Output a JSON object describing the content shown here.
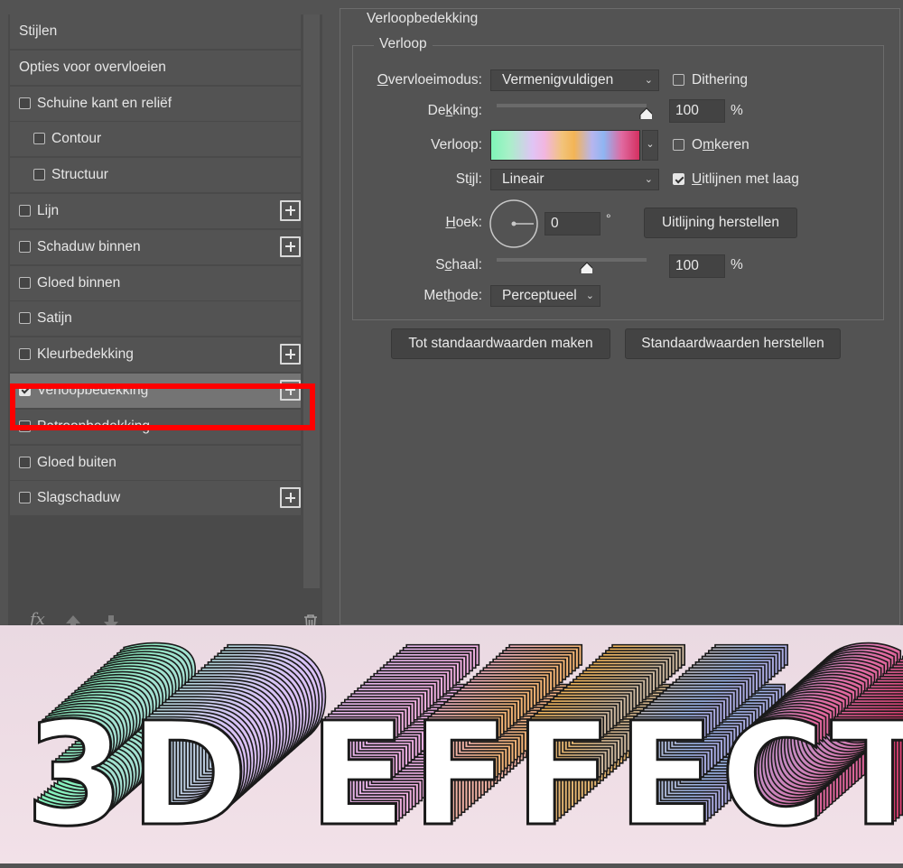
{
  "styles_panel": {
    "items": [
      {
        "label": "Stijlen",
        "checkbox": false,
        "checked": false,
        "indent": 0,
        "plus": false,
        "selected": false
      },
      {
        "label": "Opties voor overvloeien",
        "checkbox": false,
        "checked": false,
        "indent": 0,
        "plus": false,
        "selected": false
      },
      {
        "label": "Schuine kant en reliëf",
        "checkbox": true,
        "checked": false,
        "indent": 0,
        "plus": false,
        "selected": false
      },
      {
        "label": "Contour",
        "checkbox": true,
        "checked": false,
        "indent": 1,
        "plus": false,
        "selected": false
      },
      {
        "label": "Structuur",
        "checkbox": true,
        "checked": false,
        "indent": 1,
        "plus": false,
        "selected": false
      },
      {
        "label": "Lijn",
        "checkbox": true,
        "checked": false,
        "indent": 0,
        "plus": true,
        "selected": false
      },
      {
        "label": "Schaduw binnen",
        "checkbox": true,
        "checked": false,
        "indent": 0,
        "plus": true,
        "selected": false
      },
      {
        "label": "Gloed binnen",
        "checkbox": true,
        "checked": false,
        "indent": 0,
        "plus": false,
        "selected": false
      },
      {
        "label": "Satijn",
        "checkbox": true,
        "checked": false,
        "indent": 0,
        "plus": false,
        "selected": false
      },
      {
        "label": "Kleurbedekking",
        "checkbox": true,
        "checked": false,
        "indent": 0,
        "plus": true,
        "selected": false
      },
      {
        "label": "Verloopbedekking",
        "checkbox": true,
        "checked": true,
        "indent": 0,
        "plus": true,
        "selected": true
      },
      {
        "label": "Patroonbedekking",
        "checkbox": true,
        "checked": false,
        "indent": 0,
        "plus": false,
        "selected": false
      },
      {
        "label": "Gloed buiten",
        "checkbox": true,
        "checked": false,
        "indent": 0,
        "plus": false,
        "selected": false
      },
      {
        "label": "Slagschaduw",
        "checkbox": true,
        "checked": false,
        "indent": 0,
        "plus": true,
        "selected": false
      }
    ],
    "tools": {
      "fx": "fx",
      "up_icon": "arrow-up-icon",
      "down_icon": "arrow-down-icon",
      "trash_icon": "trash-icon"
    }
  },
  "settings": {
    "section_title": "Verloopbedekking",
    "group_title": "Verloop",
    "blend_mode": {
      "label_before": "",
      "label_underline": "O",
      "label_after": "vervloeimodus:",
      "value": "Vermenigvuldigen"
    },
    "dithering": {
      "label": "Dithering",
      "checked": false
    },
    "opacity": {
      "label_before": "De",
      "label_underline": "k",
      "label_after": "king:",
      "value": "100",
      "unit": "%",
      "level": 1.0
    },
    "gradient": {
      "label": "Verloop:",
      "colors": [
        "#7ff5b8",
        "#e0c4f5",
        "#f3b455",
        "#8fb5f2",
        "#d43060"
      ]
    },
    "reverse": {
      "label_before": "O",
      "label_underline": "m",
      "label_after": "keren",
      "checked": false
    },
    "style": {
      "label_before": "St",
      "label_underline": "i",
      "label_after": "jl:",
      "value": "Lineair"
    },
    "align": {
      "label_before": "",
      "label_underline": "U",
      "label_after": "itlijnen met laag",
      "checked": true
    },
    "angle": {
      "label_before": "",
      "label_underline": "H",
      "label_after": "oek:",
      "value": "0",
      "unit": "°"
    },
    "reset_alignment_button": "Uitlijning herstellen",
    "scale": {
      "label_before": "S",
      "label_underline": "c",
      "label_after": "haal:",
      "value": "100",
      "unit": "%",
      "level": 0.6
    },
    "method": {
      "label_before": "Met",
      "label_underline": "h",
      "label_after": "ode:",
      "value": "Perceptueel"
    },
    "make_default_button": "Tot standaardwaarden maken",
    "reset_default_button": "Standaardwaarden herstellen"
  },
  "artwork": {
    "text": "3D EFFECT",
    "colors": {
      "background": "#f0e0e8",
      "letter_fill": "#ffffff",
      "outline": "#1a1a1a",
      "red_highlight": "#ff0000"
    }
  }
}
